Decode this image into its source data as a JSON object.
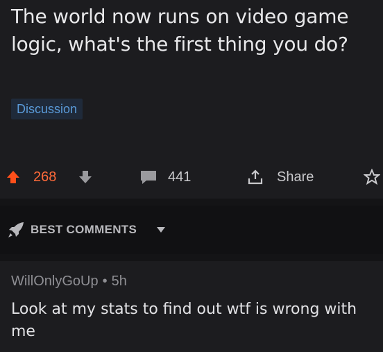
{
  "post": {
    "title": "The world now runs on video game logic, what's the first thing you do?",
    "flair": "Discussion",
    "score": "268",
    "comment_count": "441",
    "share_label": "Share",
    "icons": [
      "upvote-icon",
      "downvote-icon",
      "comment-icon",
      "share-icon",
      "award-icon"
    ]
  },
  "sort": {
    "label": "BEST COMMENTS",
    "icon": "rocket-icon"
  },
  "comment": {
    "author": "WillOnlyGoUp",
    "separator": "•",
    "age": "5h",
    "body": "Look at my stats to find out wtf is wrong with me"
  },
  "colors": {
    "upvote": "#ff4f1a",
    "flair_text": "#5a9ad8",
    "background": "#1c1c1f"
  }
}
